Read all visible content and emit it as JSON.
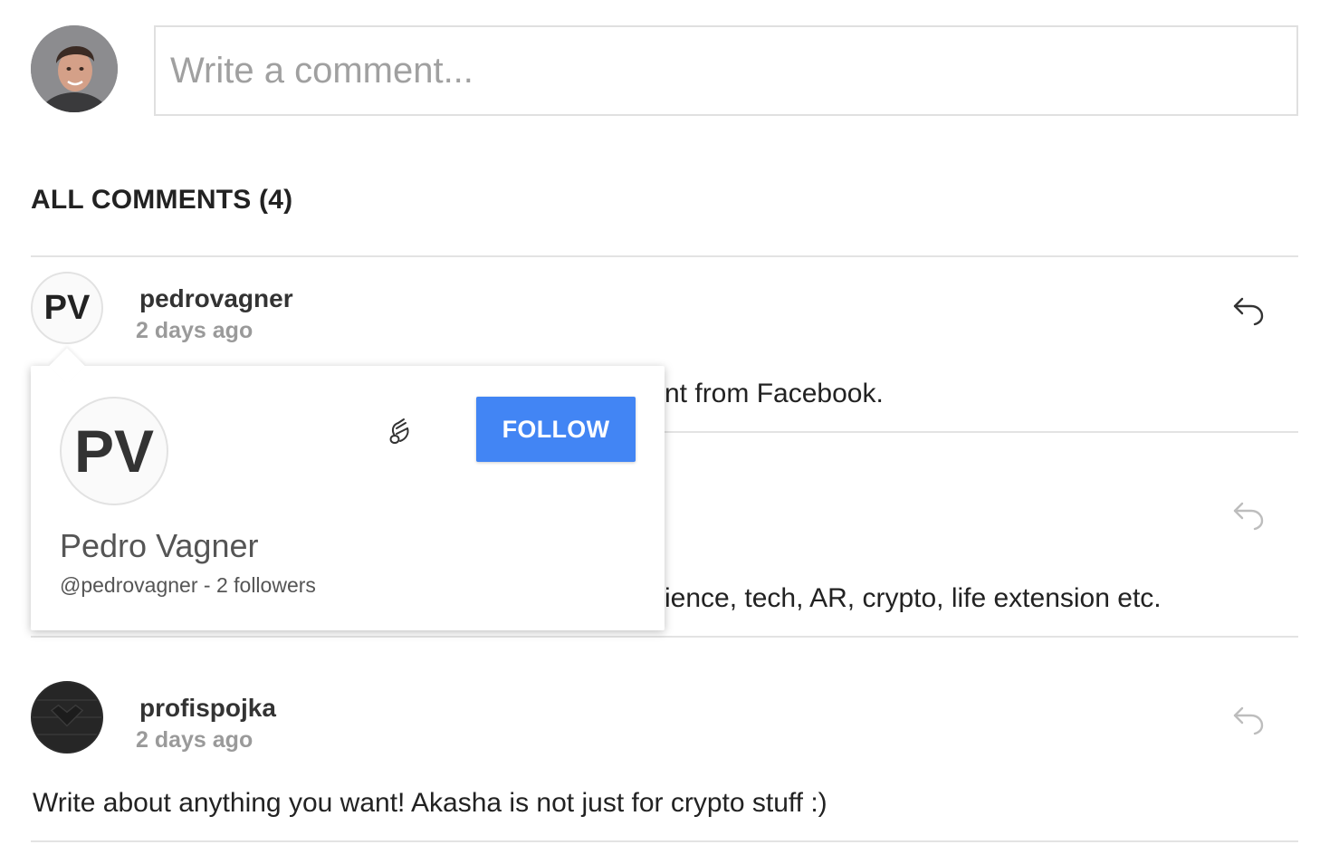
{
  "composer": {
    "placeholder": "Write a comment..."
  },
  "section_title": "ALL COMMENTS (4)",
  "comments": [
    {
      "initials": "PV",
      "author": "pedrovagner",
      "time": "2 days ago",
      "text_visible": "nt from Facebook."
    },
    {
      "text_visible": "ience, tech, AR, crypto, life extension etc."
    },
    {
      "author": "profispojka",
      "time": "2 days ago",
      "text": "Write about anything you want! Akasha is not just for crypto stuff :)"
    }
  ],
  "profile_card": {
    "initials": "PV",
    "name": "Pedro Vagner",
    "handle": "@pedrovagner",
    "separator": "-",
    "followers": "2 followers",
    "follow_label": "FOLLOW"
  },
  "colors": {
    "accent": "#4285f4",
    "muted": "#9a9a9a",
    "divider": "#e3e3e3"
  },
  "icons": [
    "reply-icon",
    "tip-icon"
  ]
}
